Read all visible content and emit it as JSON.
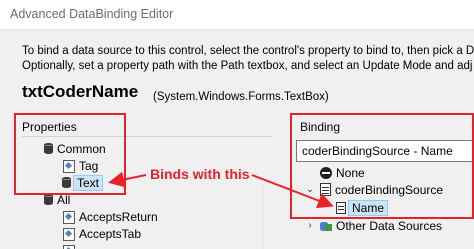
{
  "window": {
    "title": "Advanced DataBinding Editor"
  },
  "instructions": {
    "line1": "To bind a data source to this control, select the control's property to bind to, then pick a D",
    "line2": "Optionally, set a property path with the Path textbox, and select an Update Mode and adj"
  },
  "control": {
    "name": "txtCoderName",
    "type": "(System.Windows.Forms.TextBox)"
  },
  "properties": {
    "label": "Properties",
    "tree": {
      "common": "Common",
      "tag": "Tag",
      "text": "Text",
      "all": "All",
      "accepts_return": "AcceptsReturn",
      "accepts_tab": "AcceptsTab"
    }
  },
  "binding": {
    "label": "Binding",
    "current_value": "coderBindingSource - Name",
    "tree": {
      "none": "None",
      "source": "coderBindingSource",
      "field": "Name",
      "other": "Other Data Sources"
    }
  },
  "annotation": {
    "text": "Binds with this"
  },
  "colors": {
    "highlight": "#e8222a",
    "selection": "#cce4f7"
  }
}
